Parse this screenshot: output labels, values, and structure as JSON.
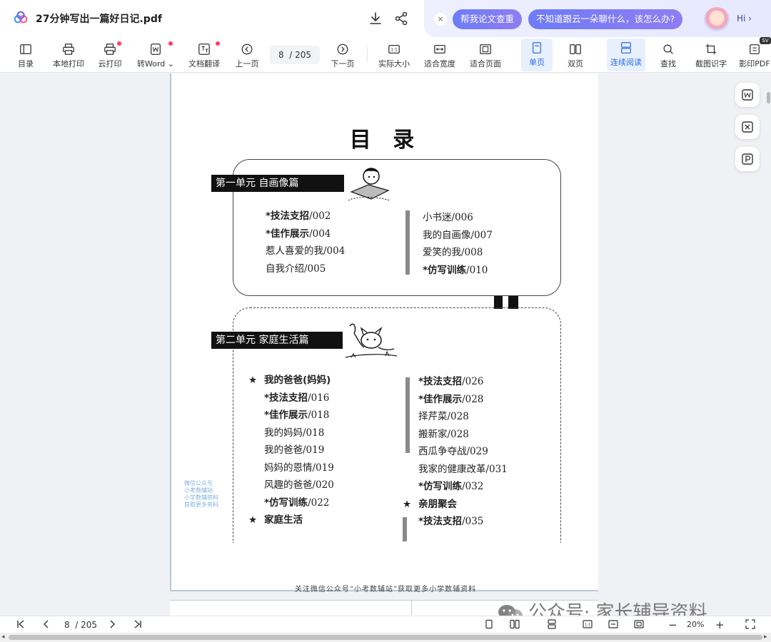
{
  "titlebar": {
    "doc_title": "27分钟写出一篇好日记.pdf",
    "icons": [
      "cloud-logo-icon",
      "download-icon",
      "share-icon"
    ]
  },
  "promo": {
    "pill1": "帮我论文查重",
    "pill2": "不知道跟云一朵聊什么，该怎么办?",
    "hi": "Hi ›",
    "close": "×"
  },
  "toolbar": {
    "toc": "目录",
    "local_print": "本地打印",
    "cloud_print": "云打印",
    "to_word": "转Word",
    "translate": "文档翻译",
    "prev_page": "上一页",
    "page_current": "8",
    "page_total": "205",
    "next_page": "下一页",
    "actual_size": "实际大小",
    "fit_width": "适合宽度",
    "fit_page": "适合页面",
    "single_page": "单页",
    "double_page": "双页",
    "continuous": "连续阅读",
    "find": "查找",
    "ocr": "截图识字",
    "scan_pdf": "影印PDF",
    "badge": "SV"
  },
  "document": {
    "toc_title": "目 录",
    "unit1": {
      "head": "第一单元  自画像篇",
      "left": [
        {
          "bold": "*技法支招",
          "num": "/002"
        },
        {
          "bold": "*佳作展示",
          "num": "/004"
        },
        {
          "text": "惹人喜爱的我/004"
        },
        {
          "text": "自我介绍/005"
        }
      ],
      "right": [
        {
          "text": "小书迷/006"
        },
        {
          "text": "我的自画像/007"
        },
        {
          "text": "爱笑的我/008"
        },
        {
          "bold": "*仿写训练",
          "num": "/010"
        }
      ]
    },
    "unit2": {
      "head": "第二单元  家庭生活篇",
      "left": [
        {
          "star": "★",
          "bold": "我的爸爸(妈妈)",
          "num": ""
        },
        {
          "bold": "*技法支招",
          "num": "/016"
        },
        {
          "bold": "*佳作展示",
          "num": "/018"
        },
        {
          "text": "我的妈妈/018"
        },
        {
          "text": "我的爸爸/019"
        },
        {
          "text": "妈妈的恩情/019"
        },
        {
          "text": "风趣的爸爸/020"
        },
        {
          "bold": "*仿写训练",
          "num": "/022"
        },
        {
          "star": "★",
          "bold": "家庭生活",
          "num": ""
        }
      ],
      "right": [
        {
          "bold": "*技法支招",
          "num": "/026"
        },
        {
          "bold": "*佳作展示",
          "num": "/028"
        },
        {
          "text": "择芹菜/028"
        },
        {
          "text": "搬新家/028"
        },
        {
          "text": "西瓜争夺战/029"
        },
        {
          "text": "我家的健康改革/031"
        },
        {
          "bold": "*仿写训练",
          "num": "/032"
        },
        {
          "star": "★",
          "bold": "亲朋聚会",
          "num": ""
        },
        {
          "bold": "*技法支招",
          "num": "/035"
        }
      ]
    },
    "footer_note": "关注微信公众号“小考数辅站”获取更多小学数辅资料",
    "stamp": [
      "微信公众号",
      "小考数辅站",
      "小学数辅资料",
      "获取更多资料"
    ]
  },
  "bottombar": {
    "page_current": "8",
    "page_total": "205",
    "zoom": "20%"
  },
  "watermark": "公众号· 家长辅导资料",
  "colors": {
    "accent": "#2f6de1",
    "promo_pill": "#7a7cf3",
    "dot": "#ff3c5f"
  }
}
